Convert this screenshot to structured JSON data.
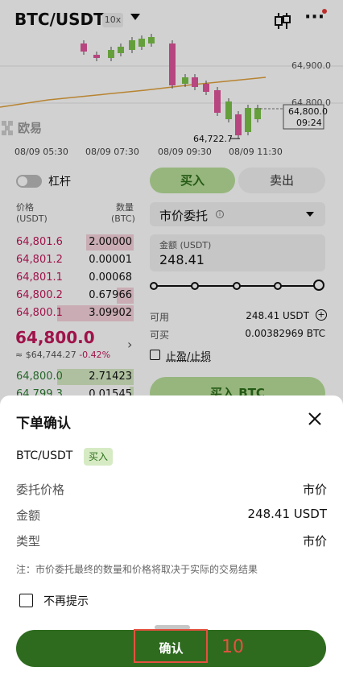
{
  "header": {
    "pair": "BTC/USDT",
    "leverage": "10x"
  },
  "chart": {
    "price_labels": [
      "64,900.0",
      "64,800.0"
    ],
    "low_marker": "64,722.7",
    "current_price_tag": "64,800.0",
    "current_time_tag": "09:24",
    "watermark": "欧易",
    "time_labels": [
      "08/09 05:30",
      "08/09 07:30",
      "08/09 09:30",
      "08/09 11:30"
    ],
    "colors": {
      "up": "#7cc24a",
      "down": "#e0559c",
      "ma": "#e0a13c"
    }
  },
  "trade_panel": {
    "leverage_label": "杠杆",
    "buy_tab": "买入",
    "sell_tab": "卖出",
    "order_type": "市价委托",
    "amount_label": "金额 (USDT)",
    "amount_value": "248.41",
    "available_label": "可用",
    "available_value": "248.41 USDT",
    "can_buy_label": "可买",
    "can_buy_value": "0.00382969 BTC",
    "tpsl_label": "止盈/止损",
    "buy_button": "买入 BTC"
  },
  "order_book": {
    "price_header": "价格",
    "price_unit": "(USDT)",
    "qty_header": "数量",
    "qty_unit": "(BTC)",
    "asks": [
      {
        "price": "64,801.6",
        "qty": "2.00000",
        "depth": 0.62
      },
      {
        "price": "64,801.2",
        "qty": "0.00001",
        "depth": 0.0
      },
      {
        "price": "64,801.1",
        "qty": "0.00068",
        "depth": 0.0
      },
      {
        "price": "64,800.2",
        "qty": "0.67966",
        "depth": 0.22
      },
      {
        "price": "64,800.1",
        "qty": "3.09902",
        "depth": 1.0
      }
    ],
    "last_price": "64,800.0",
    "last_fiat": "≈ $64,744.27",
    "last_change": "-0.42%",
    "bids": [
      {
        "price": "64,800.0",
        "qty": "2.71423",
        "depth": 1.0
      },
      {
        "price": "64,799.3",
        "qty": "0.01545",
        "depth": 0.05
      }
    ]
  },
  "sheet": {
    "title": "下单确认",
    "pair": "BTC/USDT",
    "side_badge": "买入",
    "rows": [
      {
        "key": "委托价格",
        "value": "市价"
      },
      {
        "key": "金额",
        "value": "248.41 USDT"
      },
      {
        "key": "类型",
        "value": "市价"
      }
    ],
    "note": "注：市价委托最终的数量和价格将取决于实际的交易结果",
    "no_remind": "不再提示",
    "confirm_button": "确认",
    "step_number": "10"
  }
}
